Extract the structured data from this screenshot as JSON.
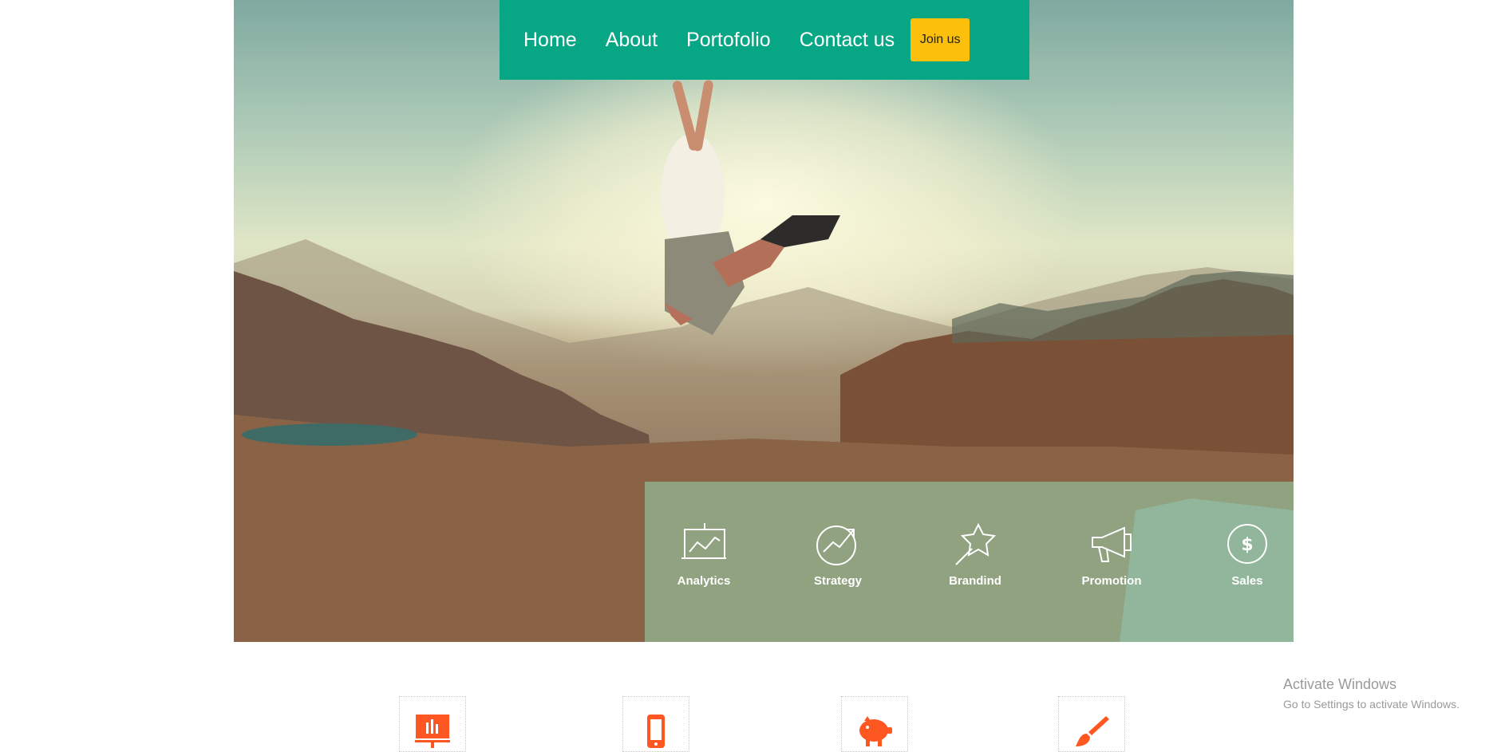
{
  "nav": {
    "links": [
      "Home",
      "About",
      "Portofolio",
      "Contact us"
    ],
    "join_label": "Join us"
  },
  "services": [
    {
      "label": "Analytics",
      "icon": "analytics-board-icon"
    },
    {
      "label": "Strategy",
      "icon": "growth-arrow-icon"
    },
    {
      "label": "Brandind",
      "icon": "magic-wand-star-icon"
    },
    {
      "label": "Promotion",
      "icon": "megaphone-icon"
    },
    {
      "label": "Sales",
      "icon": "dollar-circle-icon"
    }
  ],
  "features": [
    {
      "icon": "presentation-chart-icon"
    },
    {
      "icon": "mobile-phone-icon"
    },
    {
      "icon": "piggy-bank-icon"
    },
    {
      "icon": "paint-brush-icon"
    }
  ],
  "watermark": {
    "title": "Activate Windows",
    "subtitle": "Go to Settings to activate Windows."
  },
  "colors": {
    "nav_bg": "#07a685",
    "join_bg": "#fcbf0b",
    "feature_icon": "#ff5722",
    "services_overlay": "#96d7af"
  }
}
